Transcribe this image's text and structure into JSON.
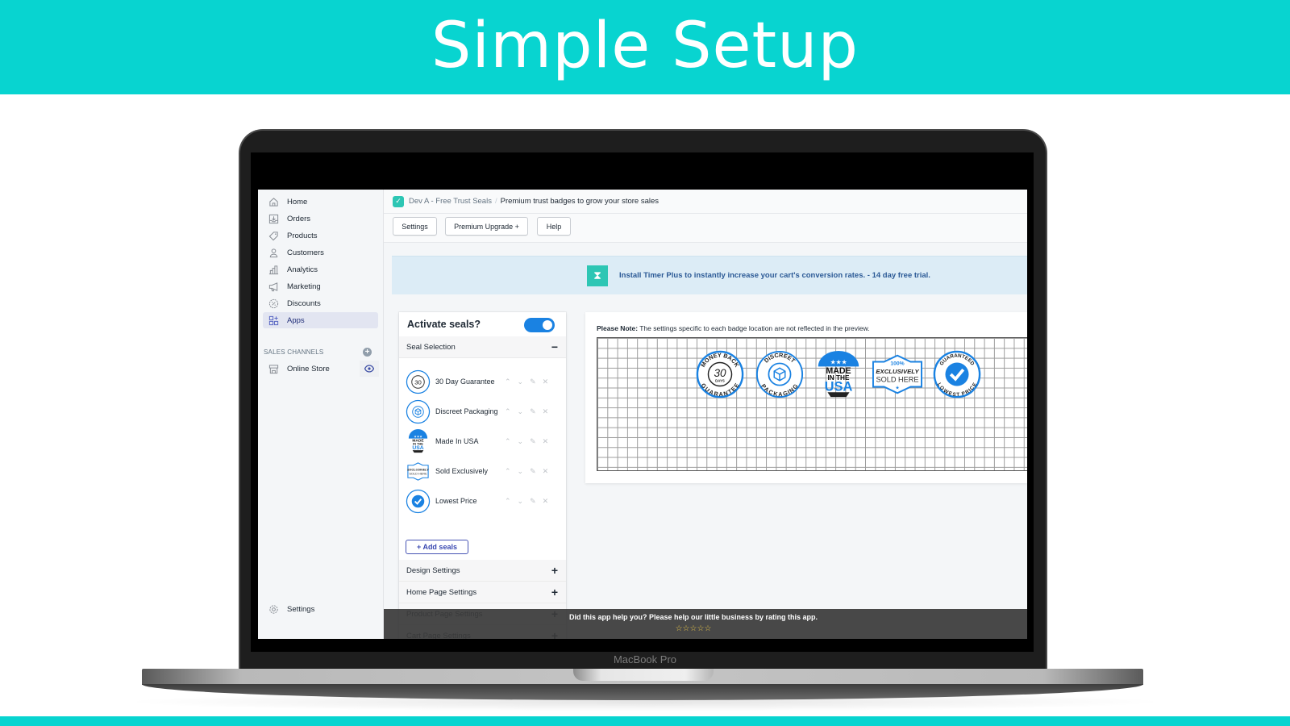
{
  "banner": {
    "title": "Simple Setup"
  },
  "device": {
    "chin_label": "MacBook Pro"
  },
  "sidebar": {
    "items": [
      {
        "label": "Home",
        "icon": "home-icon"
      },
      {
        "label": "Orders",
        "icon": "orders-icon"
      },
      {
        "label": "Products",
        "icon": "tag-icon"
      },
      {
        "label": "Customers",
        "icon": "person-icon"
      },
      {
        "label": "Analytics",
        "icon": "bar-chart-icon"
      },
      {
        "label": "Marketing",
        "icon": "megaphone-icon"
      },
      {
        "label": "Discounts",
        "icon": "discount-icon"
      },
      {
        "label": "Apps",
        "icon": "apps-icon",
        "active": true
      }
    ],
    "sales_channels_header": "SALES CHANNELS",
    "channels": [
      {
        "label": "Online Store",
        "icon": "store-icon"
      }
    ],
    "settings_label": "Settings"
  },
  "header": {
    "app_name": "Dev A - Free Trust Seals",
    "separator": "/",
    "page_title": "Premium trust badges to grow your store sales"
  },
  "tabs": [
    {
      "label": "Settings"
    },
    {
      "label": "Premium Upgrade +"
    },
    {
      "label": "Help"
    }
  ],
  "promo": {
    "text": "Install Timer Plus to instantly increase your cart's conversion rates. - 14 day free trial."
  },
  "panel": {
    "activate_label": "Activate seals?",
    "activate_on": true,
    "seal_selection_label": "Seal Selection",
    "seal_selection_expanded": "−",
    "seals": [
      {
        "name": "30 Day Guarantee"
      },
      {
        "name": "Discreet Packaging"
      },
      {
        "name": "Made In USA"
      },
      {
        "name": "Sold Exclusively"
      },
      {
        "name": "Lowest Price"
      }
    ],
    "row_actions": {
      "up": "⌃",
      "down": "⌄",
      "edit": "✎",
      "remove": "✕"
    },
    "add_seals_label": "+ Add seals",
    "sections": [
      {
        "label": "Design Settings",
        "sign": "+"
      },
      {
        "label": "Home Page Settings",
        "sign": "+"
      },
      {
        "label": "Product Page Settings",
        "sign": "+"
      },
      {
        "label": "Cart Page Settings",
        "sign": "+"
      }
    ]
  },
  "preview": {
    "note_bold": "Please Note:",
    "note_text": " The settings specific to each badge location are not reflected in the preview.",
    "badges": [
      {
        "name": "Money Back 30 Days Guarantee",
        "top": "MONEY BACK",
        "center": "30",
        "sub": "DAYS",
        "bottom": "GUARANTEE"
      },
      {
        "name": "Discreet Packaging",
        "top": "DISCREET",
        "bottom": "PACKAGING"
      },
      {
        "name": "Made In The USA",
        "line1": "MADE",
        "line2": "IN THE",
        "line3": "USA"
      },
      {
        "name": "100% Exclusively Sold Here",
        "line1": "100%",
        "line2": "EXCLUSIVELY",
        "line3": "SOLD HERE"
      },
      {
        "name": "Guaranteed Lowest Price",
        "top": "GUARANTEED",
        "bottom": "LOWEST PRICE"
      }
    ]
  },
  "rating": {
    "text": "Did this app help you? Please help our little business by rating this app.",
    "stars": "☆☆☆☆☆",
    "max_stars": 5
  },
  "colors": {
    "brand_teal": "#08d4d0",
    "toggle_blue": "#1a82e2",
    "badge_blue": "#1a82e2",
    "promo_text": "#2c5a96",
    "active_nav": "#e2e5f1"
  }
}
